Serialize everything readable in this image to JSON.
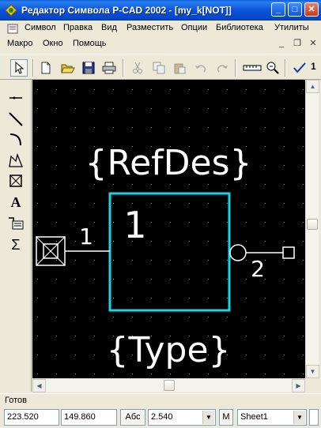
{
  "window": {
    "title": "Редактор Символа P-CAD 2002 - [my_k[NOT]]",
    "minimize_glyph": "_",
    "maximize_glyph": "□",
    "close_glyph": "✕"
  },
  "menu_main": [
    "Символ",
    "Правка",
    "Вид",
    "Разместить",
    "Опции",
    "Библиотека",
    "Утилиты"
  ],
  "menu_second": [
    "Макро",
    "Окно",
    "Помощь"
  ],
  "mdi_controls": {
    "minimize": "_",
    "restore": "❐",
    "close": "✕"
  },
  "toolbar": {
    "icons": [
      "select-arrow-icon",
      "new-file-icon",
      "open-folder-icon",
      "save-disk-icon",
      "print-icon",
      "cut-icon",
      "copy-icon",
      "paste-icon",
      "undo-icon",
      "redo-icon",
      "measure-ruler-icon",
      "zoom-icon",
      "checkmark-icon"
    ],
    "trailing_label": "1"
  },
  "palette": [
    "pin-tool-icon",
    "line-tool-icon",
    "arc-tool-icon",
    "polygon-tool-icon",
    "point-tool-icon",
    "text-tool-icon",
    "attribute-tool-icon",
    "ref-point-icon"
  ],
  "palette_text_label": "A",
  "palette_sum_label": "Σ",
  "symbol": {
    "refdes": "{RefDes}",
    "type": "{Type}",
    "body_number": "1",
    "pin_left_number": "1",
    "pin_right_number": "2",
    "colors": {
      "body": "#19d3e6",
      "pin": "#ffffff",
      "grid": "#9a9a9a",
      "background": "#000000"
    }
  },
  "status": {
    "message": "Готов",
    "x_coord": "223.520",
    "y_coord": "149.860",
    "abs_label": "Абс",
    "grid_value": "2.540",
    "m_label": "M",
    "sheet": "Sheet1"
  }
}
